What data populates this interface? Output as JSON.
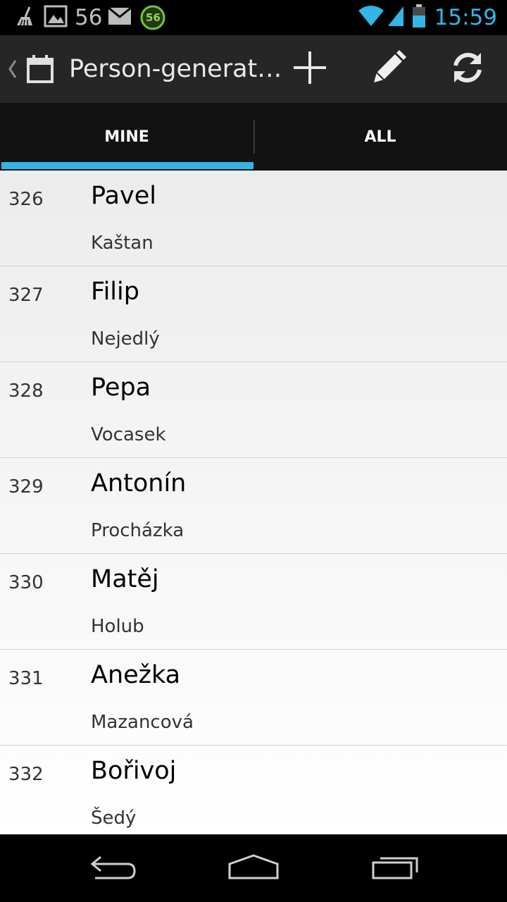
{
  "status_bar": {
    "notification_count": "56",
    "battery_badge": "56",
    "time": "15:59",
    "icons": [
      "broom-icon",
      "image-icon",
      "mail-icon",
      "battery-saver-icon",
      "wifi-icon",
      "signal-icon",
      "battery-icon"
    ]
  },
  "action_bar": {
    "title": "Person-generat…",
    "icons": [
      "back-caret-icon",
      "calendar-app-icon",
      "add-icon",
      "edit-icon",
      "refresh-icon"
    ]
  },
  "tabs": [
    {
      "label": "MINE",
      "selected": true
    },
    {
      "label": "ALL",
      "selected": false
    }
  ],
  "people": [
    {
      "id": "326",
      "first": "Pavel",
      "last": "Kaštan"
    },
    {
      "id": "327",
      "first": "Filip",
      "last": "Nejedlý"
    },
    {
      "id": "328",
      "first": "Pepa",
      "last": "Vocasek"
    },
    {
      "id": "329",
      "first": "Antonín",
      "last": "Procházka"
    },
    {
      "id": "330",
      "first": "Matěj",
      "last": "Holub"
    },
    {
      "id": "331",
      "first": "Anežka",
      "last": "Mazancová"
    },
    {
      "id": "332",
      "first": "Bořivoj",
      "last": "Šedý"
    }
  ],
  "nav_bar": {
    "icons": [
      "back-icon",
      "home-icon",
      "recent-apps-icon"
    ]
  },
  "colors": {
    "accent": "#33b5e5",
    "action_bar": "#262626",
    "tab_bar": "#121212"
  }
}
